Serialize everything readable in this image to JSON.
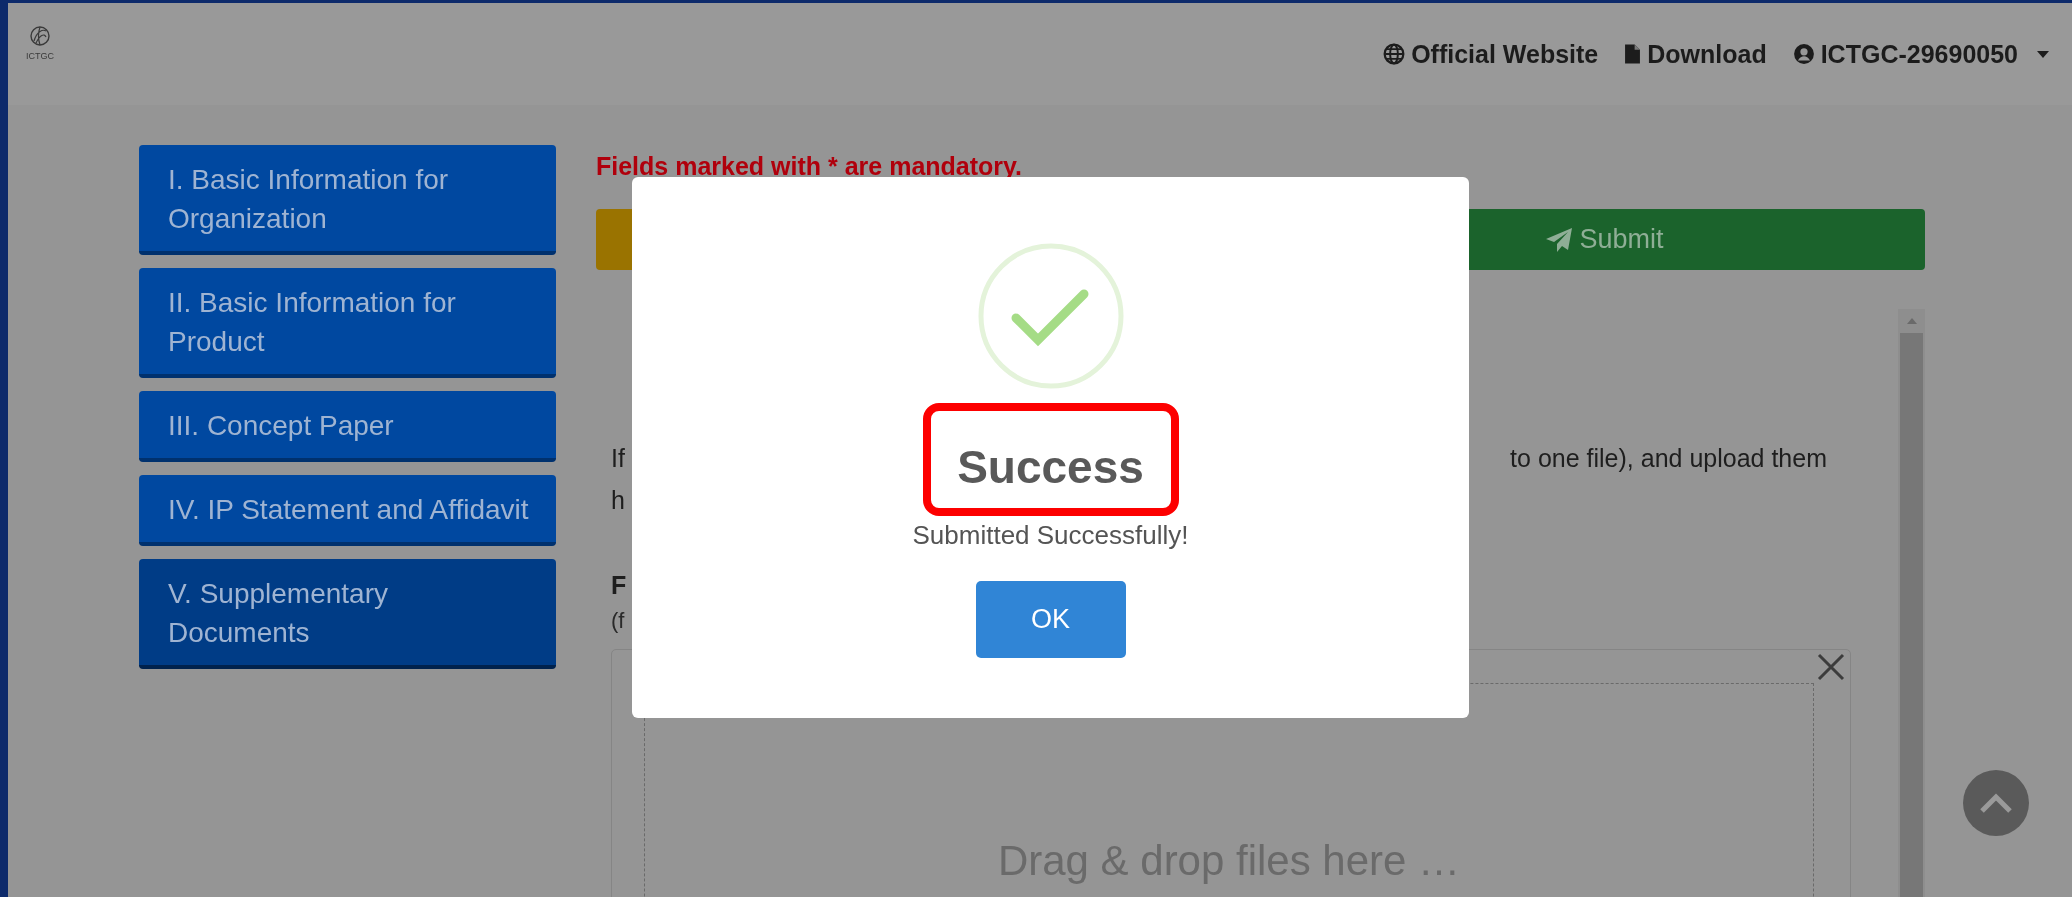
{
  "header": {
    "logo_text": "ICTGC",
    "links": [
      {
        "kind": "globe",
        "label": "Official Website"
      },
      {
        "kind": "file",
        "label": "Download"
      },
      {
        "kind": "user",
        "label": "ICTGC-29690050",
        "dropdown": true
      }
    ]
  },
  "sidebar": {
    "items": [
      {
        "label": "I. Basic Information for Organization",
        "selected": false
      },
      {
        "label": "II. Basic Information for Product",
        "selected": false
      },
      {
        "label": "III. Concept Paper",
        "selected": false
      },
      {
        "label": "IV. IP Statement and Affidavit",
        "selected": false
      },
      {
        "label": "V. Supplementary Documents",
        "selected": true
      }
    ]
  },
  "form": {
    "notice": "Fields marked with * are mandatory.",
    "buttons": [
      {
        "kind": "warning"
      },
      {
        "kind": "submit",
        "label": "Submit"
      }
    ]
  },
  "section": {
    "paragraph_left": [
      "If",
      "h"
    ],
    "paragraph_right": "to one file), and upload them",
    "field_label": "F",
    "field_hint": "(f",
    "drop_text": "Drag & drop files here …"
  },
  "modal": {
    "title": "Success",
    "title_highlighted": true,
    "message": "Submitted Successfully!",
    "button": "OK"
  }
}
